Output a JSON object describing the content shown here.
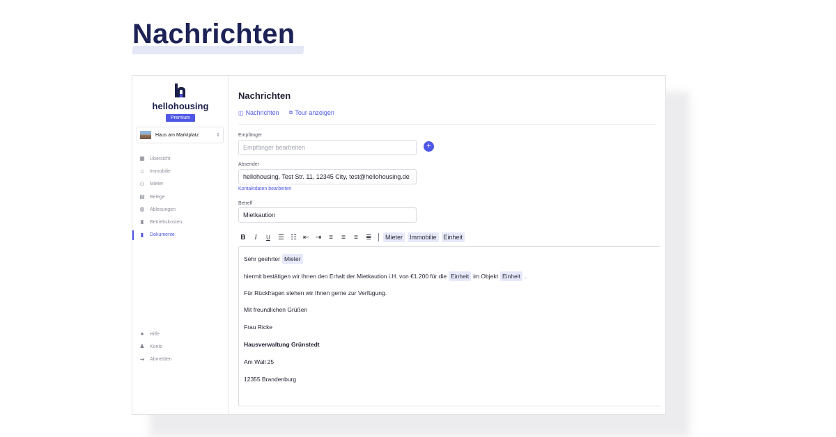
{
  "hero": {
    "title": "Nachrichten"
  },
  "sidebar": {
    "brand": "hellohousing",
    "plan_badge": "Premium",
    "property": {
      "name": "Haus am Marktplatz"
    },
    "items": [
      {
        "label": "Übersicht",
        "icon": "dashboard-icon"
      },
      {
        "label": "Immobilie",
        "icon": "home-icon"
      },
      {
        "label": "Mieter",
        "icon": "users-icon"
      },
      {
        "label": "Belege",
        "icon": "receipt-icon"
      },
      {
        "label": "Ablesungen",
        "icon": "gauge-icon"
      },
      {
        "label": "Betriebskosten",
        "icon": "costs-icon"
      },
      {
        "label": "Dokumente",
        "icon": "document-icon"
      }
    ],
    "bottom_items": [
      {
        "label": "Hilfe",
        "icon": "help-icon"
      },
      {
        "label": "Konto",
        "icon": "user-icon"
      },
      {
        "label": "Abmelden",
        "icon": "logout-icon"
      }
    ]
  },
  "main": {
    "heading": "Nachrichten",
    "links": {
      "messages": "Nachrichten",
      "tour": "Tour anzeigen"
    },
    "recipient": {
      "label": "Empfänger",
      "placeholder": "Empfänger bearbeiten"
    },
    "sender": {
      "label": "Absender",
      "value": "hellohousing, Test Str. 11, 12345 City, test@hellohousing.de",
      "edit_link": "Kontaktdaten bearbeiten"
    },
    "subject": {
      "label": "Betreff",
      "value": "Mietkaution"
    },
    "toolbar": {
      "bold": "B",
      "italic": "I",
      "underline": "U",
      "placeholders": [
        "Mieter",
        "Immobilie",
        "Einheit"
      ]
    },
    "body": {
      "greeting": "Sehr geehrter",
      "greeting_tag": "Mieter",
      "line1_a": "hiermit bestätigen wir Ihnen den Erhalt der Mietkaution i.H. von €1.200 für die",
      "line1_tag1": "Einheit",
      "line1_b": "im Objekt",
      "line1_tag2": "Einheit",
      "line1_end": ".",
      "line2": "Für Rückfragen stehen wir Ihnen gerne zur Verfügung.",
      "closing": "Mit freundlichen Grüßen",
      "signer": "Frau Ricke",
      "company": "Hausverwaltung Grünstedt",
      "street": "Am Wall 25",
      "city": "12355 Brandenburg"
    }
  },
  "colors": {
    "accent": "#4e57e6",
    "brand": "#1b1f4b"
  }
}
